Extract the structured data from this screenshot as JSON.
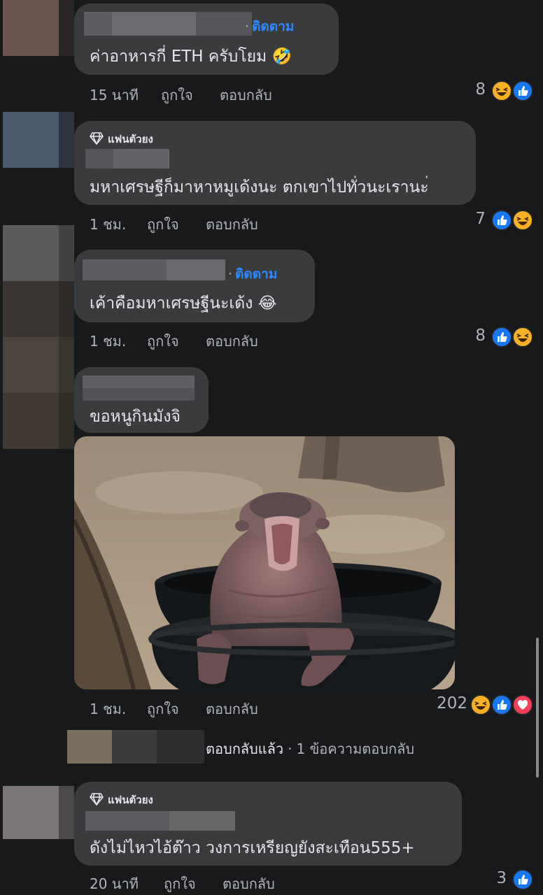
{
  "colors": {
    "background": "#18191a",
    "bubble": "#3a3b3c",
    "follow": "#2d88ff",
    "meta": "#b0b3b8",
    "text": "#e4e6eb"
  },
  "comments": [
    {
      "follow": "ติดตาม",
      "text": "ค่าอาหารกี่ ETH  ครับโยม 🤣",
      "time": "15 นาที",
      "like": "ถูกใจ",
      "reply": "ตอบกลับ",
      "reaction_count": "8",
      "reactions": [
        "haha-icon",
        "like-icon"
      ]
    },
    {
      "badge": "แฟนตัวยง",
      "text": "มหาเศรษฐีก็มาหาหมูเด้งนะ ตกเขาไปทั่วนะเรานะ่",
      "time": "1 ชม.",
      "like": "ถูกใจ",
      "reply": "ตอบกลับ",
      "reaction_count": "7",
      "reactions": [
        "like-icon",
        "haha-icon"
      ]
    },
    {
      "follow": "ติดตาม",
      "text": "เค้าคือมหาเศรษฐีนะเด้ง 😂",
      "time": "1 ชม.",
      "like": "ถูกใจ",
      "reply": "ตอบกลับ",
      "reaction_count": "8",
      "reactions": [
        "like-icon",
        "haha-icon"
      ]
    },
    {
      "text": "ขอหนูกินมังจิ",
      "image": "baby-hippo-photo",
      "time": "1 ชม.",
      "like": "ถูกใจ",
      "reply": "ตอบกลับ",
      "reaction_count": "202",
      "reactions": [
        "haha-icon",
        "like-icon",
        "love-icon"
      ],
      "replies_summary": "ตอบกลับแล้ว",
      "replies_count_text": "1 ข้อความตอบกลับ"
    },
    {
      "badge": "แฟนตัวยง",
      "text": "ดังไม่ไหวไอ้ต๊าว วงการเหรียญยังสะเทือน555+",
      "time": "20 นาที",
      "like": "ถูกใจ",
      "reply": "ตอบกลับ",
      "reaction_count": "3",
      "reactions": [
        "like-icon"
      ]
    }
  ]
}
